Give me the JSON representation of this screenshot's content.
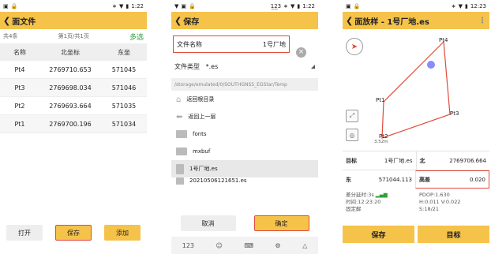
{
  "status": {
    "p1_time": "1:22",
    "p2_time": "1:22",
    "p3_time": "12:23",
    "p2_network": "1̲2̲3"
  },
  "panel1": {
    "title": "面文件",
    "count": "共4条",
    "page": "第1页/共1页",
    "multi_select": "多选",
    "columns": [
      "名称",
      "北坐标",
      "东坐"
    ],
    "rows": [
      [
        "Pt4",
        "2769710.653",
        "571045"
      ],
      [
        "Pt3",
        "2769698.034",
        "571046"
      ],
      [
        "Pt2",
        "2769693.664",
        "571035"
      ],
      [
        "Pt1",
        "2769700.196",
        "571034"
      ]
    ],
    "buttons": {
      "open": "打开",
      "save": "保存",
      "add": "添加"
    }
  },
  "panel2": {
    "title": "保存",
    "name_label": "文件名称",
    "name_value": "1号厂地",
    "type_label": "文件类型",
    "type_value": "*.es",
    "path": "/storage/emulated/0/SOUTHGNSS_EGStar/Temp",
    "files": [
      {
        "name": "返回根目录",
        "icon": "home-icon"
      },
      {
        "name": "返回上一层",
        "icon": "back-arrow-icon"
      },
      {
        "name": "fonts",
        "icon": "folder-icon"
      },
      {
        "name": "mxbuf",
        "icon": "folder-icon"
      },
      {
        "name": "1号厂地.es",
        "icon": "file-icon"
      },
      {
        "name": "20210506121651.es",
        "icon": "file-icon"
      }
    ],
    "cancel": "取消",
    "confirm": "确定",
    "keyboard": [
      "123",
      "☺",
      "⌨",
      "⚙",
      "△"
    ]
  },
  "panel3": {
    "title": "面放样 - 1号厂地.es",
    "points": [
      {
        "label": "Pt4"
      },
      {
        "label": "Pt1"
      },
      {
        "label": "Pt3"
      },
      {
        "label": "Pt2"
      }
    ],
    "scale": "3.52m",
    "target_label": "目标",
    "target_value": "1号厂地.es",
    "north_label": "北",
    "north_value": "2769706.664",
    "east_label": "东",
    "east_value": "571044.113",
    "height_label": "高差",
    "height_value": "0.020",
    "diff_delay": "差分延时:3s",
    "time": "时间:12:23:20",
    "fix": "固定解",
    "pdop": "PDOP:1.630",
    "hv": "H:0.011  V:0.022",
    "sats": "S:18/21",
    "save": "保存",
    "target_btn": "目标"
  },
  "colors": {
    "accent": "#f5c24a",
    "highlight": "#e04a3a",
    "green": "#2e9e3a"
  }
}
